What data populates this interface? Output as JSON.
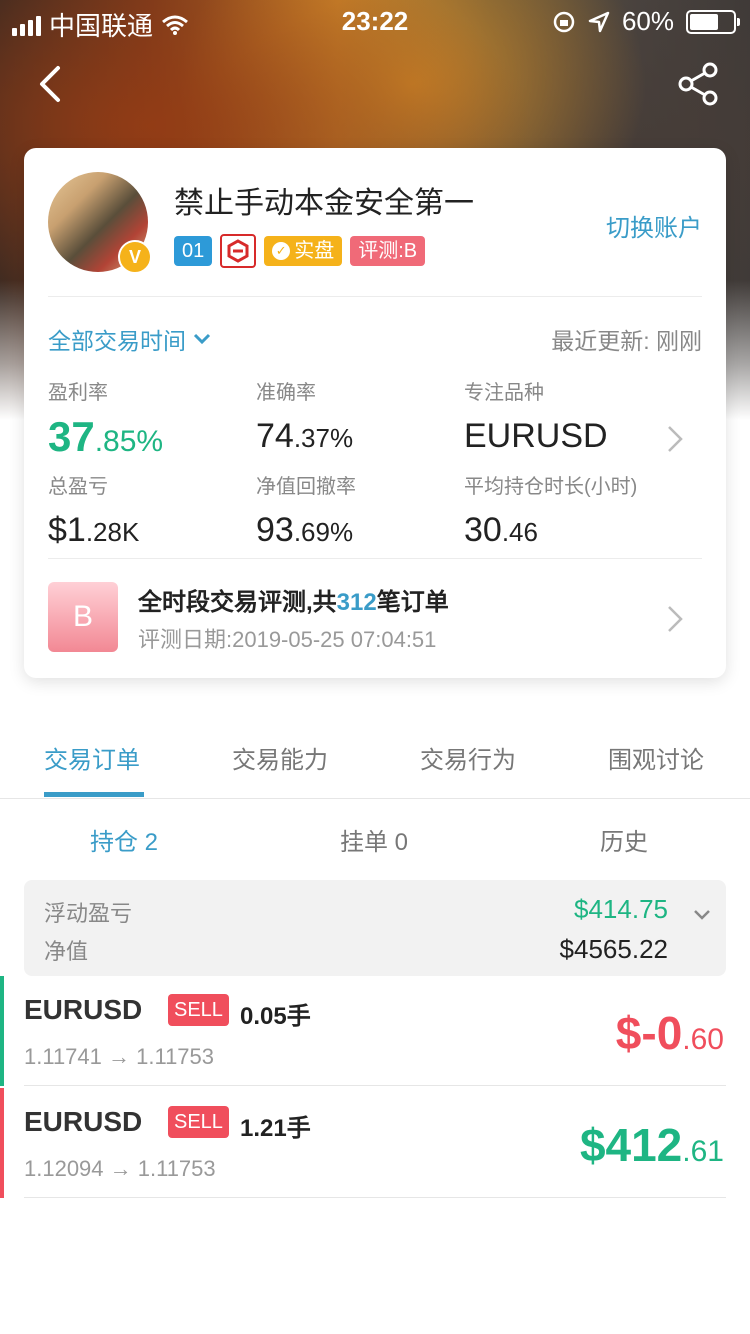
{
  "status_bar": {
    "carrier": "中国联通",
    "time": "23:22",
    "battery": "60%"
  },
  "profile": {
    "name": "禁止手动本金安全第一",
    "switch_account": "切换账户",
    "tag_number": "01",
    "tag_real": "实盘",
    "tag_eval": "评测:B",
    "verified_badge": "V"
  },
  "filter": {
    "time_range": "全部交易时间",
    "updated_label": "最近更新:",
    "updated_value": "刚刚"
  },
  "stats": {
    "profit_rate": {
      "label": "盈利率",
      "int": "37",
      "frac": ".85%"
    },
    "accuracy": {
      "label": "准确率",
      "int": "74",
      "frac": ".37%"
    },
    "focus_symbol": {
      "label": "专注品种",
      "value": "EURUSD"
    },
    "total_pnl": {
      "label": "总盈亏",
      "int": "$1",
      "frac": ".28K"
    },
    "drawdown": {
      "label": "净值回撤率",
      "int": "93",
      "frac": ".69%"
    },
    "avg_hold": {
      "label": "平均持仓时长(小时)",
      "int": "30",
      "frac": ".46"
    }
  },
  "evaluation": {
    "grade": "B",
    "title_prefix": "全时段交易评测,共",
    "order_count": "312",
    "title_suffix": "笔订单",
    "date": "评测日期:2019-05-25 07:04:51"
  },
  "tabs": [
    "交易订单",
    "交易能力",
    "交易行为",
    "围观讨论"
  ],
  "subtabs": {
    "positions": "持仓 2",
    "pending": "挂单 0",
    "history": "历史"
  },
  "summary": {
    "floating_label": "浮动盈亏",
    "floating_value": "$414.75",
    "equity_label": "净值",
    "equity_value": "$4565.22"
  },
  "positions": [
    {
      "symbol": "EURUSD",
      "side": "SELL",
      "lots": "0.05手",
      "prices": "1.11741 → 1.11753",
      "pnl_int": "$-0",
      "pnl_frac": ".60",
      "color": "#f04e5c",
      "bar_color": "#1eb583"
    },
    {
      "symbol": "EURUSD",
      "side": "SELL",
      "lots": "1.21手",
      "prices": "1.12094 → 1.11753",
      "pnl_int": "$412",
      "pnl_frac": ".61",
      "color": "#1eb583",
      "bar_color": "#f04e5c"
    }
  ],
  "colors": {
    "accent": "#3a9cc8",
    "green": "#1eb583",
    "red": "#f04e5c"
  }
}
